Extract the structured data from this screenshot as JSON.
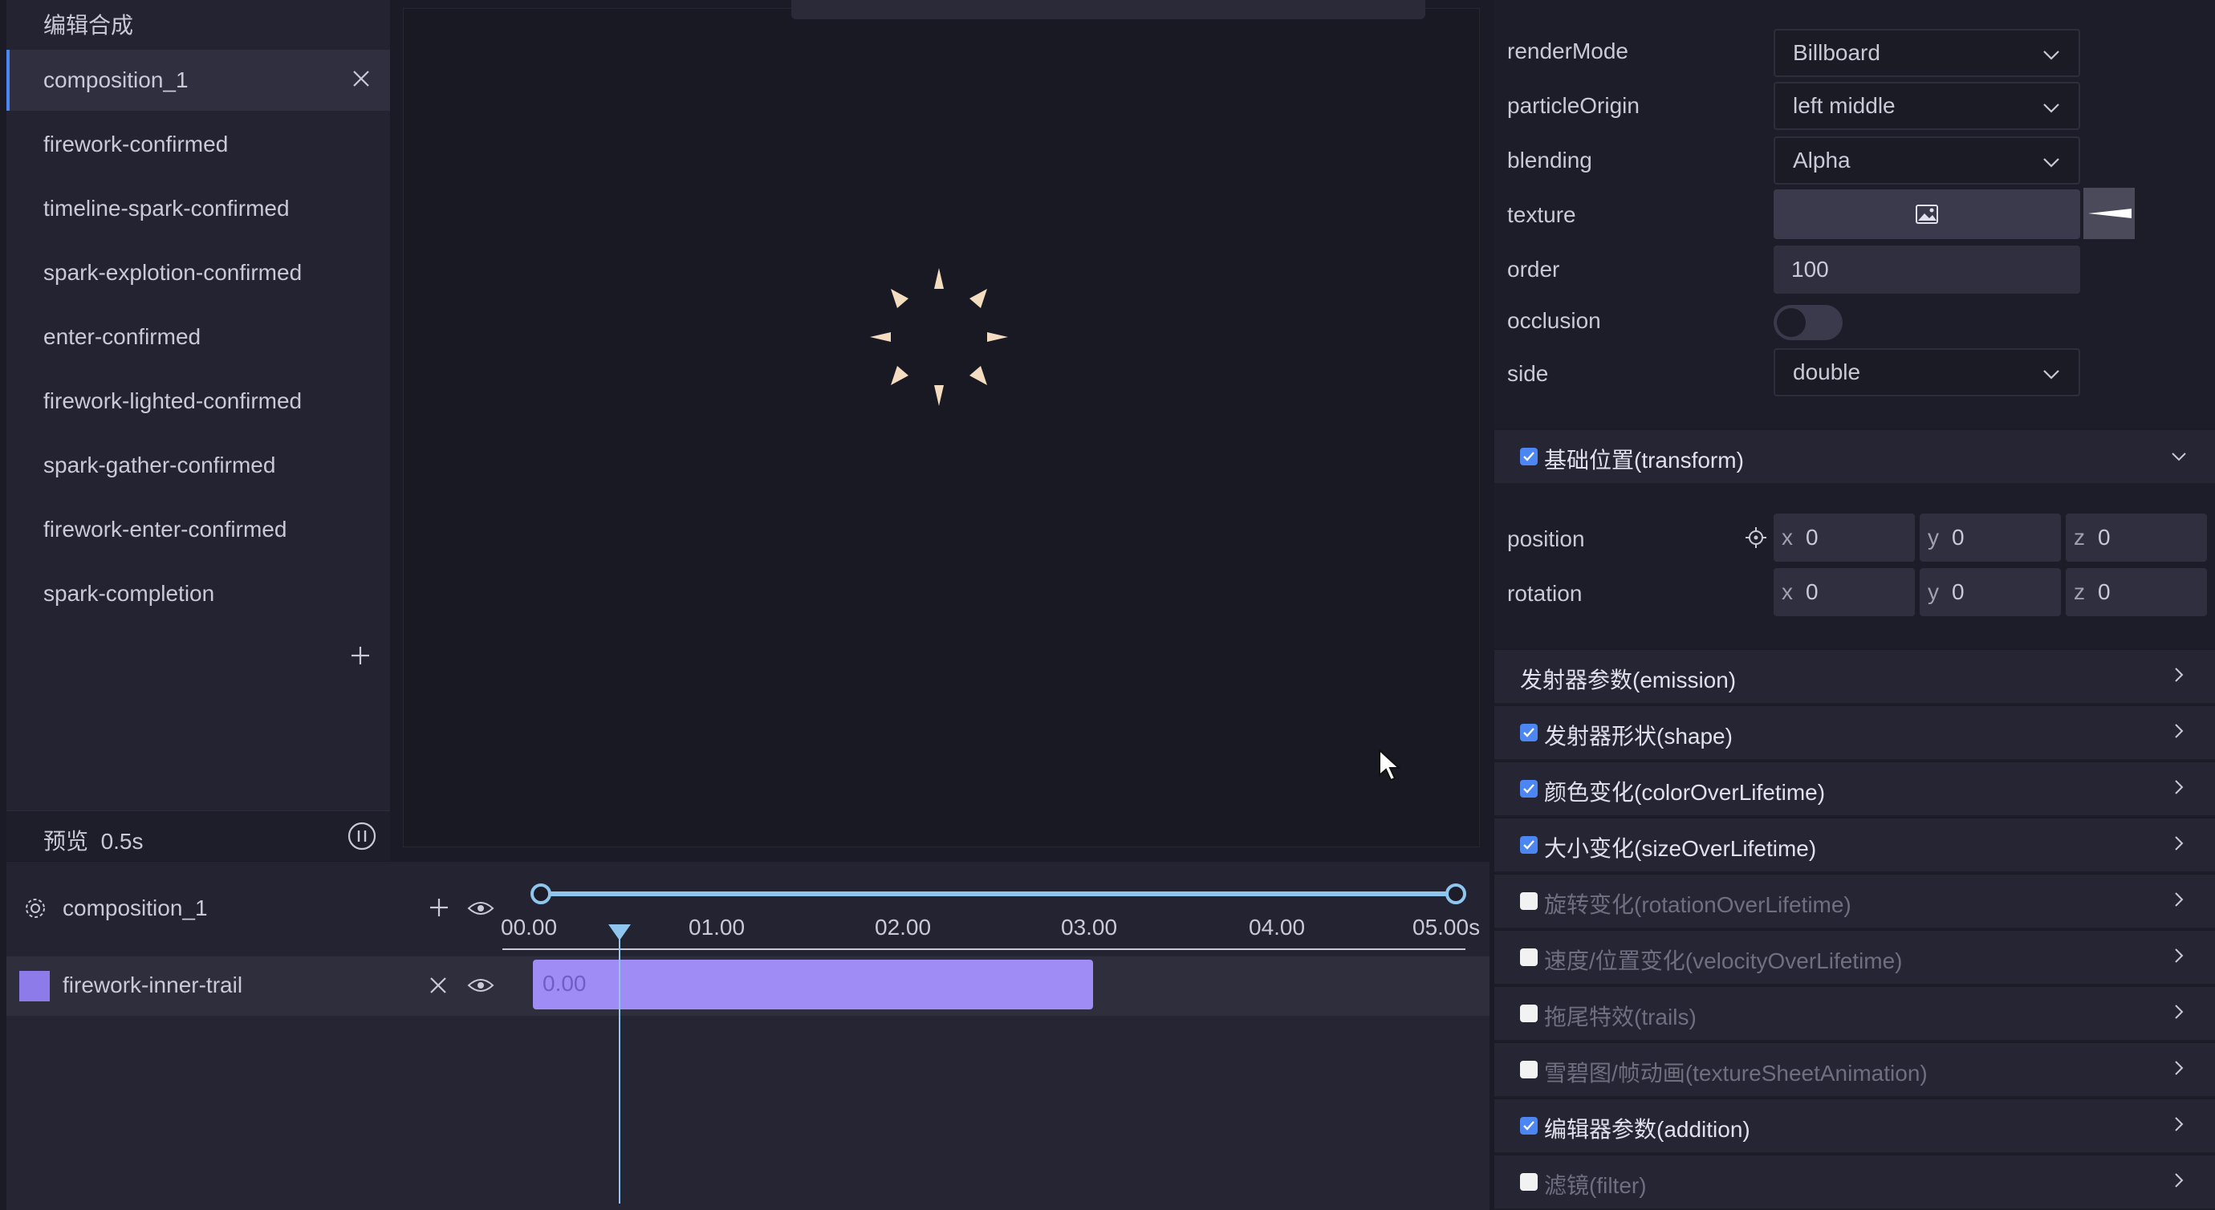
{
  "left_panel": {
    "header": "编辑合成",
    "compositions": [
      {
        "label": "composition_1",
        "active": true
      },
      {
        "label": "firework-confirmed"
      },
      {
        "label": "timeline-spark-confirmed"
      },
      {
        "label": "spark-explotion-confirmed"
      },
      {
        "label": "enter-confirmed"
      },
      {
        "label": "firework-lighted-confirmed"
      },
      {
        "label": "spark-gather-confirmed"
      },
      {
        "label": "firework-enter-confirmed"
      },
      {
        "label": "spark-completion"
      }
    ],
    "preview": {
      "label": "预览",
      "time": "0.5s"
    }
  },
  "timeline": {
    "composition_name": "composition_1",
    "ticks": [
      "00.00",
      "01.00",
      "02.00",
      "03.00",
      "04.00",
      "05.00s"
    ],
    "track": {
      "name": "firework-inner-trail",
      "clip_label": "0.00",
      "color": "#8c7be8"
    }
  },
  "properties": {
    "renderMode": {
      "label": "renderMode",
      "value": "Billboard"
    },
    "particleOrigin": {
      "label": "particleOrigin",
      "value": "left middle"
    },
    "blending": {
      "label": "blending",
      "value": "Alpha"
    },
    "texture": {
      "label": "texture"
    },
    "order": {
      "label": "order",
      "value": "100"
    },
    "occlusion": {
      "label": "occlusion",
      "value": false
    },
    "side": {
      "label": "side",
      "value": "double"
    }
  },
  "transform": {
    "title": "基础位置(transform)",
    "enabled": true,
    "position": {
      "label": "position",
      "x": "0",
      "y": "0",
      "z": "0"
    },
    "rotation": {
      "label": "rotation",
      "x": "0",
      "y": "0",
      "z": "0"
    },
    "axis_labels": {
      "x": "x",
      "y": "y",
      "z": "z"
    }
  },
  "sections": [
    {
      "title": "发射器参数(emission)",
      "checkbox": null
    },
    {
      "title": "发射器形状(shape)",
      "checkbox": true
    },
    {
      "title": "颜色变化(colorOverLifetime)",
      "checkbox": true
    },
    {
      "title": "大小变化(sizeOverLifetime)",
      "checkbox": true
    },
    {
      "title": "旋转变化(rotationOverLifetime)",
      "checkbox": false
    },
    {
      "title": "速度/位置变化(velocityOverLifetime)",
      "checkbox": false
    },
    {
      "title": "拖尾特效(trails)",
      "checkbox": false
    },
    {
      "title": "雪碧图/帧动画(textureSheetAnimation)",
      "checkbox": false
    },
    {
      "title": "编辑器参数(addition)",
      "checkbox": true
    },
    {
      "title": "滤镜(filter)",
      "checkbox": false
    }
  ],
  "colors": {
    "accent": "#4c86f2",
    "timeline_accent": "#8fc6ee",
    "clip": "#a08cf5",
    "panel_bg": "#232331"
  }
}
